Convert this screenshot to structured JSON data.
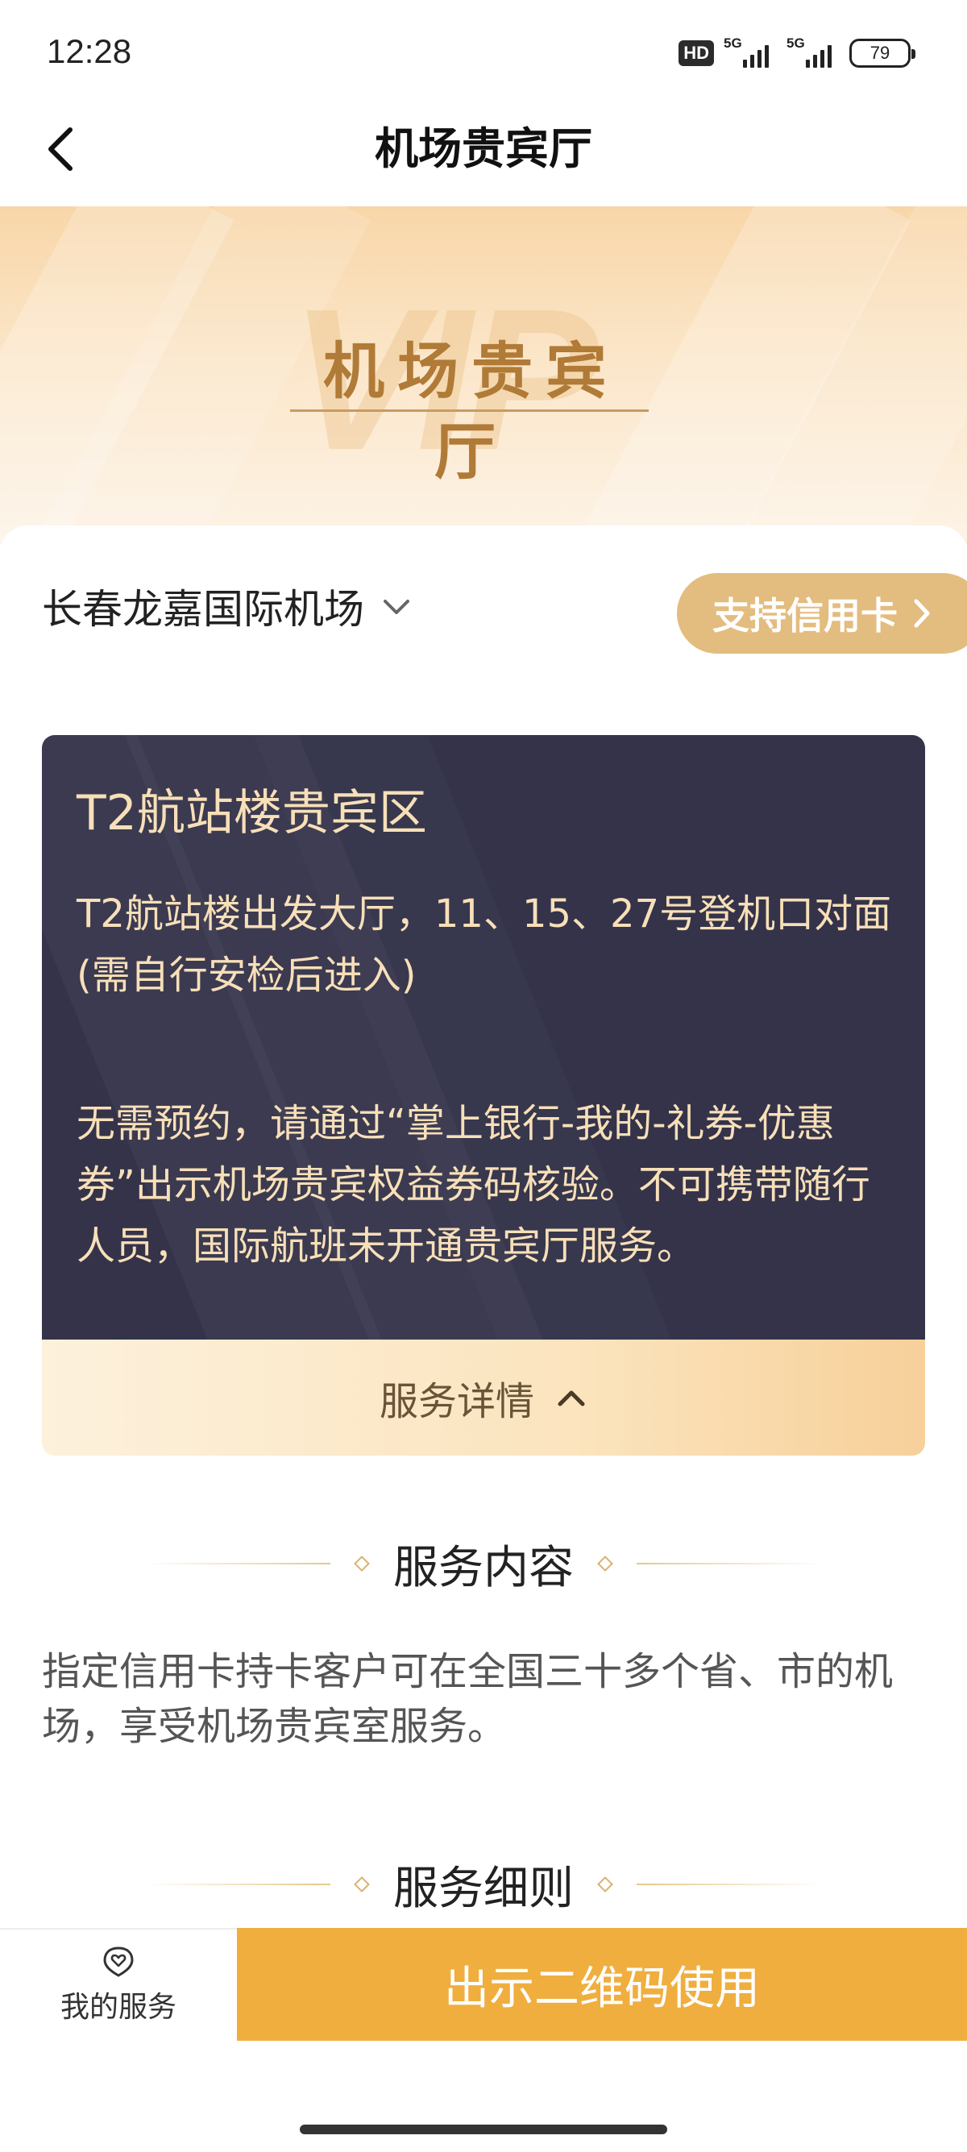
{
  "status_bar": {
    "time": "12:28",
    "hd_badge": "HD",
    "network_1": "5G",
    "network_2": "5G",
    "battery": "79"
  },
  "nav": {
    "title": "机场贵宾厅",
    "back_icon": "chevron-left-icon"
  },
  "banner": {
    "watermark": "VIP",
    "title": "机场贵宾厅"
  },
  "airport_selector": {
    "name": "长春龙嘉国际机场",
    "icon": "chevron-down-icon"
  },
  "credit_card_button": {
    "label": "支持信用卡",
    "icon": "chevron-right-icon"
  },
  "lounge": {
    "name": "T2航站楼贵宾区",
    "location": "T2航站楼出发大厅，11、15、27号登机口对面(需自行安检后进入)",
    "notice": "无需预约，请通过“掌上银行-我的-礼券-优惠券”出示机场贵宾权益券码核验。不可携带随行人员，国际航班未开通贵宾厅服务。",
    "detail_toggle_label": "服务详情",
    "detail_toggle_icon": "chevron-up-icon"
  },
  "service_content": {
    "heading": "服务内容",
    "text": "指定信用卡持卡客户可在全国三十多个省、市的机场，享受机场贵宾室服务。"
  },
  "service_rules": {
    "heading": "服务细则"
  },
  "bottom_bar": {
    "my_services_label": "我的服务",
    "my_services_icon": "heart-chat-icon",
    "primary_button_label": "出示二维码使用"
  },
  "colors": {
    "accent_gold": "#e3bc7f",
    "primary_orange": "#f0ae3e",
    "card_dark": "#34334a",
    "card_text": "#f7dfb8"
  }
}
